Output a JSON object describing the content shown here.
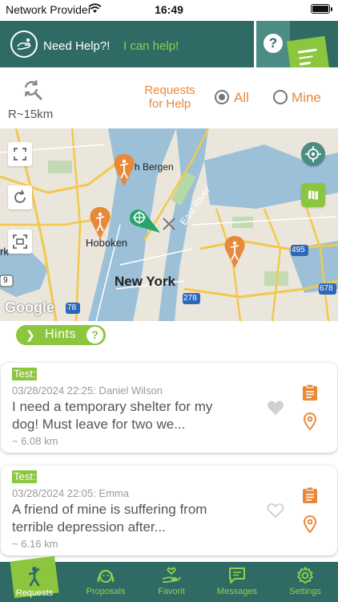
{
  "status_bar": {
    "provider": "Network Provider",
    "time": "16:49"
  },
  "header": {
    "need_help": "Need Help?!",
    "can_help": "I can help!",
    "question_symbol": "?"
  },
  "filter": {
    "radius": "R~15km",
    "requests_label_line1": "Requests",
    "requests_label_line2": "for Help",
    "option_all": "All",
    "option_mine": "Mine",
    "selected": "All"
  },
  "map": {
    "labels": {
      "north_bergen": "h Bergen",
      "hoboken": "Hoboken",
      "new_york": "New York",
      "east_river": "East River",
      "york_fragment": "rk",
      "route_9": "9",
      "route_78": "78",
      "route_278": "278",
      "route_495": "495",
      "route_678": "678"
    },
    "attribution": "Google"
  },
  "hints": {
    "label": "Hints",
    "help_symbol": "?"
  },
  "requests": [
    {
      "tag": "Test:",
      "meta": "03/28/2024 22:25: Daniel Wilson",
      "body_line1": "I need a temporary shelter for my",
      "body_line2": "dog! Must leave for two we...",
      "distance": "~ 6.08 km",
      "favorited": true
    },
    {
      "tag": "Test:",
      "meta": "03/28/2024 22:05: Emma",
      "body_line1": "A friend of mine is suffering from",
      "body_line2": "terrible depression after...",
      "distance": "~ 6.16 km",
      "favorited": false
    }
  ],
  "bottom_nav": [
    {
      "label": "Requests",
      "icon": "person-raising-hand-icon",
      "active": true
    },
    {
      "label": "Proposals",
      "icon": "helper-face-icon",
      "active": false
    },
    {
      "label": "Favorit",
      "icon": "hand-heart-icon",
      "active": false
    },
    {
      "label": "Messages",
      "icon": "chat-bubble-icon",
      "active": false
    },
    {
      "label": "Settings",
      "icon": "gear-icon",
      "active": false
    }
  ],
  "colors": {
    "header_teal": "#2f6b64",
    "accent_green": "#8cc63f",
    "accent_orange": "#e8893a",
    "light_green_text": "#8ed14b"
  }
}
